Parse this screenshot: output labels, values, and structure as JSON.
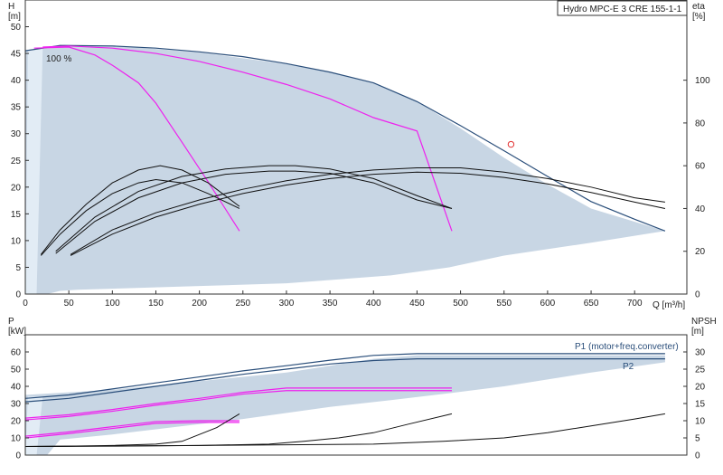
{
  "title_box": "Hydro MPC-E 3 CRE 155-1-1",
  "upper": {
    "left_axis_label": "H",
    "left_axis_unit": "[m]",
    "right_axis_label": "eta",
    "right_axis_unit": "[%]",
    "x_axis_label": "Q [m³/h]",
    "annotation": "100 %"
  },
  "lower": {
    "left_axis_label": "P",
    "left_axis_unit": "[kW]",
    "right_axis_label": "NPSH",
    "right_axis_unit": "[m]",
    "p1_label": "P1 (motor+freq.converter)",
    "p2_label": "P2"
  },
  "colors": {
    "envelope": "#c8d6e4",
    "envelope_light": "#e2ecf5",
    "max_curve": "#2a4e7a",
    "speed_curve": "#ee22ee",
    "eta_curve": "#111111",
    "duty_point": "#e23030",
    "npsh_curve": "#111111"
  },
  "chart_data": [
    {
      "type": "line",
      "panel": "head_efficiency",
      "xlim": [
        0,
        760
      ],
      "x_ticks": [
        0,
        50,
        100,
        150,
        200,
        250,
        300,
        350,
        400,
        450,
        500,
        550,
        600,
        650,
        700
      ],
      "ylim": [
        0,
        55
      ],
      "y_ticks": [
        0,
        5,
        10,
        15,
        20,
        25,
        30,
        35,
        40,
        45,
        50
      ],
      "y2lim": [
        0,
        137.5
      ],
      "y2_ticks": [
        0,
        20,
        40,
        60,
        80,
        100
      ],
      "envelope": [
        [
          0,
          45.5
        ],
        [
          45,
          46.6
        ],
        [
          100,
          46.5
        ],
        [
          200,
          45.2
        ],
        [
          300,
          43
        ],
        [
          350,
          41.5
        ],
        [
          400,
          39.5
        ],
        [
          450,
          36
        ],
        [
          500,
          31
        ],
        [
          550,
          25.5
        ],
        [
          600,
          20.5
        ],
        [
          650,
          16
        ],
        [
          735,
          11.8
        ],
        [
          650,
          9.6
        ],
        [
          550,
          7.2
        ],
        [
          487,
          5
        ],
        [
          420,
          3.5
        ],
        [
          300,
          2
        ],
        [
          200,
          1.5
        ],
        [
          100,
          1
        ],
        [
          60,
          0.8
        ],
        [
          40,
          0.6
        ],
        [
          25,
          0
        ],
        [
          0,
          0
        ]
      ],
      "envelope_light_zone": [
        [
          3,
          45.6
        ],
        [
          20,
          46
        ],
        [
          13,
          0
        ],
        [
          0,
          0
        ]
      ],
      "series": [
        {
          "role": "max",
          "x": [
            0,
            40,
            100,
            150,
            200,
            250,
            300,
            350,
            400,
            450,
            500,
            550,
            600,
            650,
            700,
            735
          ],
          "y": [
            45.5,
            46.5,
            46.4,
            46,
            45.3,
            44.4,
            43.1,
            41.5,
            39.5,
            36,
            31.5,
            26.8,
            22,
            17.3,
            14,
            11.8
          ]
        },
        {
          "role": "speed",
          "x": [
            10,
            50,
            80,
            100,
            130,
            150,
            180,
            210,
            246
          ],
          "y": [
            46,
            46.2,
            44.7,
            42.8,
            39.5,
            35.7,
            28.4,
            21,
            11.8
          ]
        },
        {
          "role": "speed",
          "x": [
            20,
            50,
            100,
            150,
            200,
            250,
            300,
            350,
            400,
            450,
            490
          ],
          "y": [
            46.2,
            46.4,
            46,
            45,
            43.5,
            41.5,
            39.2,
            36.5,
            33,
            30.5,
            11.8
          ]
        },
        {
          "role": "eta",
          "x": [
            18,
            40,
            70,
            100,
            130,
            155,
            180,
            210,
            246
          ],
          "y": [
            18.5,
            30,
            42,
            52,
            58,
            60,
            58,
            52,
            41
          ]
        },
        {
          "role": "eta",
          "x": [
            18,
            40,
            70,
            100,
            130,
            150,
            180,
            210,
            246
          ],
          "y": [
            18,
            28,
            39,
            47,
            52,
            53.5,
            52,
            47,
            40
          ]
        },
        {
          "role": "eta",
          "x": [
            35,
            80,
            130,
            180,
            230,
            280,
            310,
            350,
            400,
            450,
            490
          ],
          "y": [
            20,
            36,
            48,
            55,
            58.5,
            60,
            60,
            58.5,
            54,
            46,
            40
          ]
        },
        {
          "role": "eta",
          "x": [
            35,
            80,
            130,
            180,
            230,
            280,
            310,
            350,
            400,
            450,
            490
          ],
          "y": [
            19,
            34,
            45,
            52,
            56,
            57.5,
            57.5,
            56.5,
            52,
            44,
            40
          ]
        },
        {
          "role": "eta",
          "x": [
            52,
            100,
            150,
            200,
            250,
            300,
            350,
            400,
            450,
            500,
            550,
            600,
            650,
            700,
            735
          ],
          "y": [
            18.5,
            30,
            38,
            44,
            49,
            53,
            56,
            58,
            59,
            59,
            57,
            54,
            50,
            45,
            43
          ]
        },
        {
          "role": "eta",
          "x": [
            52,
            100,
            150,
            200,
            250,
            300,
            350,
            400,
            450,
            500,
            550,
            600,
            650,
            700,
            735
          ],
          "y": [
            18,
            28,
            36,
            42,
            47,
            51,
            54,
            56,
            57,
            56.5,
            54.5,
            51.5,
            47.5,
            43,
            40
          ]
        }
      ],
      "duty_point": {
        "x": 558,
        "y": 28
      }
    },
    {
      "type": "line",
      "panel": "power_npsh",
      "xlim": [
        0,
        760
      ],
      "ylim": [
        0,
        70
      ],
      "y_ticks": [
        0,
        10,
        20,
        30,
        40,
        50,
        60
      ],
      "y2lim": [
        0,
        35
      ],
      "y2_ticks": [
        0,
        5,
        10,
        15,
        20,
        25,
        30
      ],
      "envelope": [
        [
          0,
          35
        ],
        [
          100,
          38
        ],
        [
          200,
          43
        ],
        [
          300,
          48
        ],
        [
          350,
          52
        ],
        [
          400,
          56
        ],
        [
          450,
          58
        ],
        [
          735,
          58
        ],
        [
          735,
          54
        ],
        [
          650,
          48
        ],
        [
          550,
          40
        ],
        [
          487,
          36
        ],
        [
          420,
          32
        ],
        [
          350,
          28
        ],
        [
          250,
          21
        ],
        [
          200,
          18
        ],
        [
          150,
          15
        ],
        [
          100,
          12
        ],
        [
          60,
          10
        ],
        [
          40,
          9
        ],
        [
          25,
          0
        ],
        [
          0,
          0
        ]
      ],
      "envelope_light_zone": [
        [
          3,
          34
        ],
        [
          20,
          34
        ],
        [
          13,
          0
        ],
        [
          0,
          0
        ]
      ],
      "series": [
        {
          "role": "P1",
          "x": [
            0,
            50,
            100,
            150,
            200,
            250,
            300,
            350,
            400,
            450,
            500,
            600,
            735
          ],
          "y": [
            33,
            35,
            38.5,
            42,
            45.5,
            49,
            52,
            55.2,
            58,
            59,
            59,
            59,
            59
          ]
        },
        {
          "role": "P2",
          "x": [
            0,
            50,
            100,
            150,
            200,
            250,
            300,
            350,
            400,
            450,
            500,
            600,
            735
          ],
          "y": [
            31,
            33,
            36.5,
            40,
            43.5,
            47,
            50,
            53,
            55,
            56,
            56,
            56,
            56
          ]
        },
        {
          "role": "speed_power",
          "x": [
            0,
            50,
            100,
            150,
            200,
            246
          ],
          "y": [
            11,
            13.5,
            16.5,
            19.5,
            20,
            20
          ]
        },
        {
          "role": "speed_power",
          "x": [
            0,
            50,
            100,
            150,
            200,
            246
          ],
          "y": [
            10,
            12.5,
            15.5,
            18.5,
            19,
            19
          ]
        },
        {
          "role": "speed_power",
          "x": [
            0,
            50,
            100,
            150,
            200,
            250,
            300,
            350,
            400,
            490
          ],
          "y": [
            21.5,
            23.5,
            26.5,
            30,
            33,
            36.5,
            39,
            39,
            39,
            39
          ]
        },
        {
          "role": "speed_power",
          "x": [
            0,
            50,
            100,
            150,
            200,
            250,
            300,
            350,
            400,
            490
          ],
          "y": [
            20.5,
            22.5,
            25.5,
            29,
            32,
            35.5,
            37.5,
            37.5,
            37.5,
            37.5
          ]
        },
        {
          "role": "npsh",
          "x": [
            0,
            50,
            100,
            150,
            180,
            200,
            220,
            246
          ],
          "y": [
            2.5,
            2.6,
            2.8,
            3.2,
            4,
            6,
            8,
            12
          ]
        },
        {
          "role": "npsh",
          "x": [
            0,
            100,
            200,
            280,
            320,
            360,
            400,
            440,
            490
          ],
          "y": [
            2.5,
            2.6,
            2.8,
            3.2,
            4,
            5,
            6.5,
            9,
            12
          ]
        },
        {
          "role": "npsh",
          "x": [
            0,
            200,
            400,
            480,
            550,
            600,
            650,
            700,
            735
          ],
          "y": [
            2.5,
            2.8,
            3.2,
            4,
            5,
            6.5,
            8.5,
            10.5,
            12
          ]
        }
      ]
    }
  ]
}
